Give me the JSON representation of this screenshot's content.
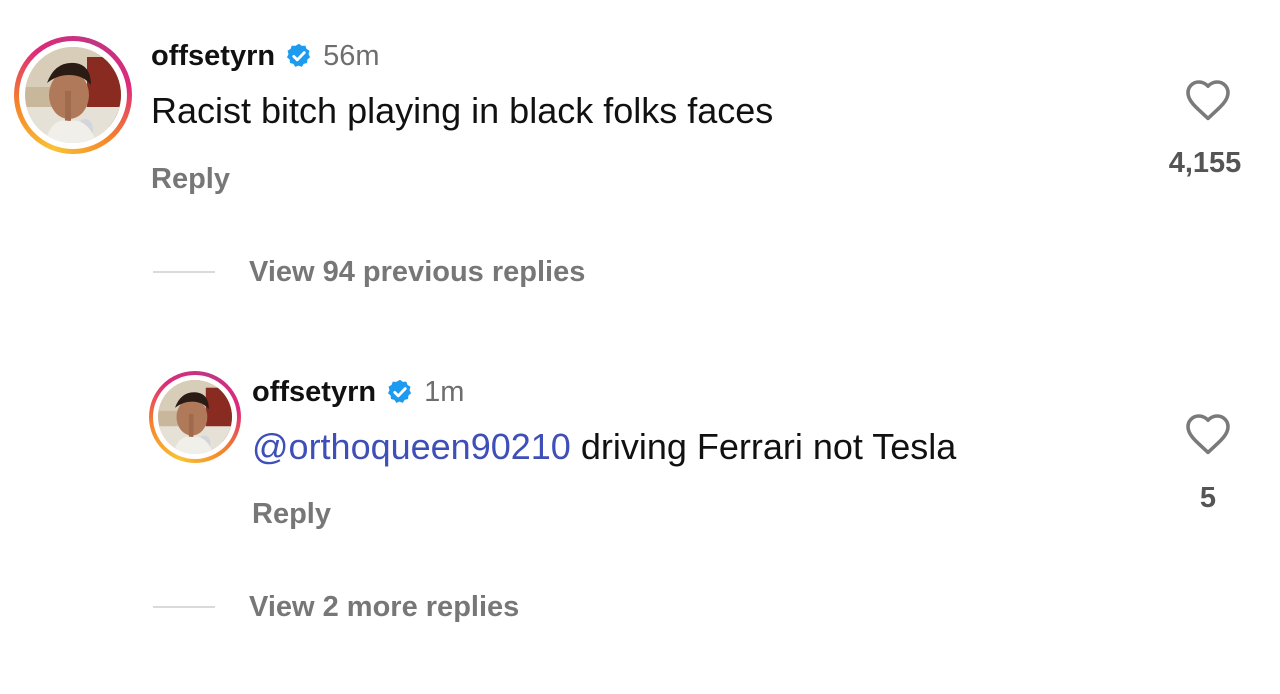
{
  "comments": [
    {
      "username": "offsetyrn",
      "verified": true,
      "time": "56m",
      "text": "Racist bitch playing in black folks faces",
      "reply_label": "Reply",
      "likes": "4,155",
      "view_replies": "View 94 previous replies"
    },
    {
      "username": "offsetyrn",
      "verified": true,
      "time": "1m",
      "mention": "@orthoqueen90210",
      "text": " driving Ferrari not Tesla",
      "reply_label": "Reply",
      "likes": "5",
      "view_replies": "View 2 more replies"
    }
  ],
  "colors": {
    "verified_badge": "#1d9bf0",
    "mention": "#3f4fb8",
    "secondary_text": "#777777"
  },
  "icons": [
    "verified-badge-icon",
    "heart-icon"
  ]
}
